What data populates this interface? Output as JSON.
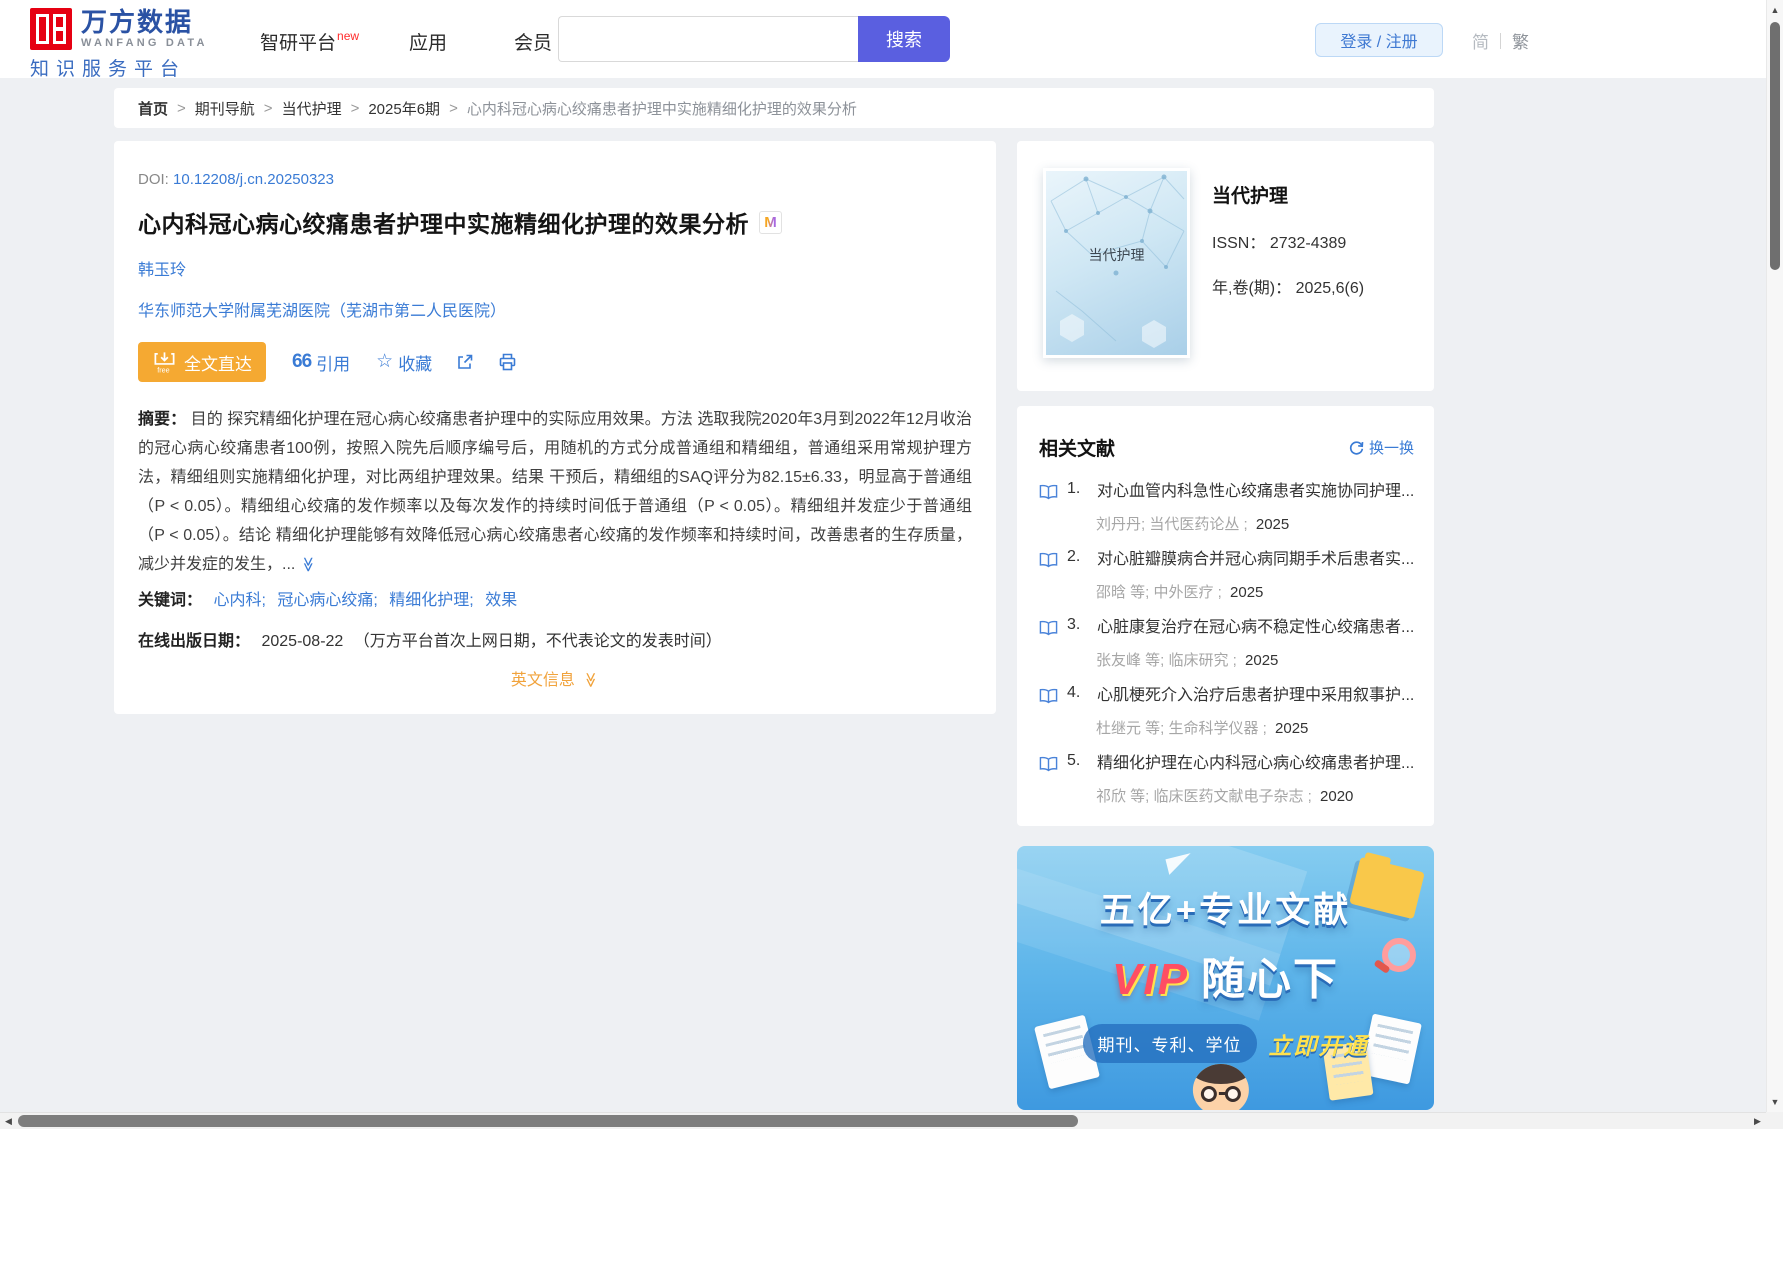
{
  "colors": {
    "primary_blue": "#3a7bd5",
    "search_purple": "#5a5fe0",
    "brand_red": "#e60012",
    "action_orange": "#f5a932",
    "english_orange": "#f1a33c"
  },
  "header": {
    "brand": "万方数据",
    "brand_en": "WANFANG DATA",
    "brand_sub": "知识服务平台",
    "nav": [
      {
        "label": "智研平台",
        "badge": "new"
      },
      {
        "label": "应用"
      },
      {
        "label": "会员"
      }
    ],
    "search_button": "搜索",
    "login_label": "登录 / 注册",
    "lang_simplified": "简",
    "lang_traditional": "繁"
  },
  "breadcrumb": {
    "separator": ">",
    "items": [
      "首页",
      "期刊导航",
      "当代护理",
      "2025年6期",
      "心内科冠心病心绞痛患者护理中实施精细化护理的效果分析"
    ]
  },
  "article": {
    "doi_label": "DOI:",
    "doi_value": "10.12208/j.cn.20250323",
    "title": "心内科冠心病心绞痛患者护理中实施精细化护理的效果分析",
    "title_badge": "M",
    "author": "韩玉玲",
    "affiliation": "华东师范大学附属芜湖医院（芜湖市第二人民医院）",
    "fulltext_button": "全文直达",
    "fulltext_free": "free",
    "cite_icon": "66",
    "cite_label": "引用",
    "favorite_icon": "☆",
    "favorite_label": "收藏",
    "abstract_label": "摘要：",
    "abstract_text": "目的 探究精细化护理在冠心病心绞痛患者护理中的实际应用效果。方法 选取我院2020年3月到2022年12月收治的冠心病心绞痛患者100例，按照入院先后顺序编号后，用随机的方式分成普通组和精细组，普通组采用常规护理方法，精细组则实施精细化护理，对比两组护理效果。结果 干预后，精细组的SAQ评分为82.15±6.33，明显高于普通组（P < 0.05）。精细组心绞痛的发作频率以及每次发作的持续时间低于普通组（P < 0.05）。精细组并发症少于普通组（P < 0.05）。结论 精细化护理能够有效降低冠心病心绞痛患者心绞痛的发作频率和持续时间，改善患者的生存质量，减少并发症的发生，...",
    "expand_icon": "≫",
    "keywords_label": "关键词：",
    "keywords": [
      "心内科;",
      "冠心病心绞痛;",
      "精细化护理;",
      "效果"
    ],
    "pubdate_label": "在线出版日期：",
    "pubdate_value": "2025-08-22",
    "pubdate_note": "（万方平台首次上网日期，不代表论文的发表时间）",
    "english_info_label": "英文信息"
  },
  "journal": {
    "cover_text": "当代护理",
    "name": "当代护理",
    "issn_label": "ISSN：",
    "issn_value": "2732-4389",
    "vol_label": "年,卷(期)：",
    "vol_value": "2025,6(6)"
  },
  "related": {
    "title": "相关文献",
    "refresh_label": "换一换",
    "items": [
      {
        "no": "1.",
        "title": "对心血管内科急性心绞痛患者实施协同护理...",
        "authors": "刘丹丹;",
        "journal": "当代医药论丛 ;",
        "year": "2025"
      },
      {
        "no": "2.",
        "title": "对心脏瓣膜病合并冠心病同期手术后患者实...",
        "authors": "邵晗 等;",
        "journal": "中外医疗 ;",
        "year": "2025"
      },
      {
        "no": "3.",
        "title": "心脏康复治疗在冠心病不稳定性心绞痛患者...",
        "authors": "张友峰 等;",
        "journal": "临床研究 ;",
        "year": "2025"
      },
      {
        "no": "4.",
        "title": "心肌梗死介入治疗后患者护理中采用叙事护...",
        "authors": "杜继元 等;",
        "journal": "生命科学仪器 ;",
        "year": "2025"
      },
      {
        "no": "5.",
        "title": "精细化护理在心内科冠心病心绞痛患者护理...",
        "authors": "祁欣 等;",
        "journal": "临床医药文献电子杂志 ;",
        "year": "2020"
      }
    ]
  },
  "ad": {
    "line1": "五亿+专业文献",
    "vip": "VIP",
    "line2": "随心下",
    "tags": "期刊、专利、学位",
    "cta": "立即开通"
  },
  "scrollbar": {
    "up": "▲",
    "down": "▼",
    "left": "◀",
    "right": "▶"
  }
}
